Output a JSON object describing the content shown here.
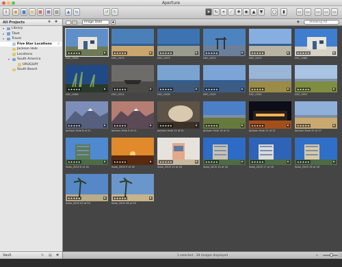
{
  "app": {
    "title": "Aperture"
  },
  "window": {
    "lights": [
      "#ec5d57",
      "#f4bf4f",
      "#61c554"
    ]
  },
  "sidebar": {
    "header": "All Projects",
    "projects": [
      {
        "label": "Library",
        "indent": 0,
        "icon": "triangle-disclosure",
        "color": "#7aa0d6"
      },
      {
        "label": "Tibet",
        "indent": 0,
        "icon": "folder",
        "color": "#7aa0d6"
      },
      {
        "label": "Travel",
        "indent": 0,
        "icon": "folder",
        "color": "#7aa0d6"
      },
      {
        "label": "Five Star Locations",
        "indent": 1,
        "icon": "smart-album",
        "color": "#b7c7e2",
        "selected": true
      },
      {
        "label": "Jackson Hole",
        "indent": 1,
        "icon": "project",
        "color": "#e2c86a"
      },
      {
        "label": "Locations",
        "indent": 1,
        "icon": "album",
        "color": "#e2c86a"
      },
      {
        "label": "South America",
        "indent": 1,
        "icon": "folder",
        "color": "#7aa0d6"
      },
      {
        "label": "URUGUAY",
        "indent": 2,
        "icon": "project",
        "color": "#e2c86a"
      },
      {
        "label": "South Beach",
        "indent": 1,
        "icon": "project",
        "color": "#e2c86a"
      }
    ],
    "footer": "Vault"
  },
  "browser": {
    "sort_value": "Image Date",
    "search_placeholder": "Showing All",
    "status": "1 selected - 38 images displayed"
  },
  "thumbnails": [
    {
      "caption": "DSC_0343",
      "rating": "★★★★★",
      "selected": true,
      "scene": "house",
      "sky": "#5f8fc9",
      "ground": "#6d7a55"
    },
    {
      "caption": "DSC_0473",
      "rating": "★★★★★",
      "scene": "sea",
      "sky": "#4a7fb8",
      "ground": "#c9a66e"
    },
    {
      "caption": "DSC_0473",
      "rating": "★★★★★",
      "scene": "sea",
      "sky": "#3d73b3",
      "ground": "#9a9c8f"
    },
    {
      "caption": "DSC_0473",
      "rating": "★★★★★",
      "scene": "pier",
      "sky": "#4d84c0",
      "ground": "#6a7f9a"
    },
    {
      "caption": "DSC_0473",
      "rating": "★★★★★",
      "scene": "sea",
      "sky": "#87aee0",
      "ground": "#b9b3a3"
    },
    {
      "caption": "DSC_0482",
      "rating": "★★★★★",
      "scene": "house",
      "sky": "#3f7ecf",
      "ground": "#d6d2c8"
    },
    {
      "caption": "DSC_0496",
      "rating": "★★★★★",
      "scene": "plants",
      "sky": "#1f4a86",
      "ground": "#2a3a2a"
    },
    {
      "caption": "DSC_0513",
      "rating": "★★★★★",
      "scene": "boat",
      "sky": "#6e6c68",
      "ground": "#4b4a46"
    },
    {
      "caption": "DSC_0528",
      "rating": "★★★★★",
      "scene": "sea",
      "sky": "#7aa3cf",
      "ground": "#3e5a7a"
    },
    {
      "caption": "DSC_0529",
      "rating": "★★★★★",
      "scene": "sea",
      "sky": "#7ca4d6",
      "ground": "#3c5c86"
    },
    {
      "caption": "DSC_0550",
      "rating": "★★★★★",
      "scene": "field",
      "sky": "#9ab6d6",
      "ground": "#9a8b46"
    },
    {
      "caption": "DSC_0551",
      "rating": "★★★★★",
      "scene": "field",
      "sky": "#a9c3e3",
      "ground": "#7e8d3f"
    },
    {
      "caption": "Jackson Hole 8 of 21",
      "rating": "★★★★★",
      "scene": "mountain",
      "sky": "#7d8fb8",
      "ground": "#55607e"
    },
    {
      "caption": "Jackson Hole 9 of 21",
      "rating": "★★★★★",
      "scene": "mountain",
      "sky": "#b67d73",
      "ground": "#5b4a55"
    },
    {
      "caption": "Jackson Hole 11 of 21",
      "rating": "★★★★★",
      "scene": "steam",
      "sky": "#5d5347",
      "ground": "#3b3127"
    },
    {
      "caption": "Jackson Hole 18 of 21",
      "rating": "★★★★★",
      "scene": "field",
      "sky": "#4b80c8",
      "ground": "#667a3e"
    },
    {
      "caption": "Jackson Hole 21 of 21",
      "rating": "★★★★★",
      "scene": "night",
      "sky": "#0d0d1a",
      "ground": "#a34f1c"
    },
    {
      "caption": "Jackson Hole 25 of 27",
      "rating": "★★★★★",
      "scene": "field",
      "sky": "#8fb0d9",
      "ground": "#c9a970"
    },
    {
      "caption": "Sobe_2005 8 of 18",
      "rating": "★★★★★",
      "scene": "city",
      "sky": "#4f8ad0",
      "ground": "#5a7a5c"
    },
    {
      "caption": "Sobe_2005 9 of 18",
      "rating": "★★★★★",
      "scene": "sunset",
      "sky": "#e08a2c",
      "ground": "#5a2a10"
    },
    {
      "caption": "Sobe_2005 12 of 18",
      "rating": "★★★★★",
      "scene": "tower",
      "sky": "#e6e3dd",
      "ground": "#c7b79c"
    },
    {
      "caption": "Sobe_2005 14 of 18",
      "rating": "★★★★★",
      "scene": "city",
      "sky": "#2d6bc6",
      "ground": "#c9c2b4"
    },
    {
      "caption": "Sobe_2005 17 of 18",
      "rating": "★★★★★",
      "scene": "city",
      "sky": "#2e63b8",
      "ground": "#dcdcdc"
    },
    {
      "caption": "Sobe_2005 18 of 18",
      "rating": "★★★★★",
      "scene": "city",
      "sky": "#2f6fc7",
      "ground": "#d8c9a6"
    },
    {
      "caption": "Sobe_2005 43 of 53",
      "rating": "★★★★★",
      "scene": "palms",
      "sky": "#5687c7",
      "ground": "#b9ab86"
    },
    {
      "caption": "Sobe_2005 48 of 53",
      "rating": "★★★★★",
      "scene": "palms",
      "sky": "#6a96cc",
      "ground": "#c8b48c"
    }
  ]
}
